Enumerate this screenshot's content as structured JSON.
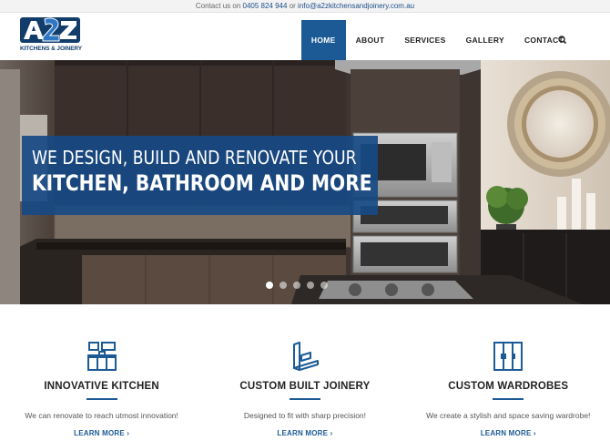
{
  "topbar": {
    "prefix": "Contact us on",
    "phone": "0405 824 944",
    "or": "or",
    "email": "info@a2zkitchensandjoinery.com.au"
  },
  "logo": {
    "mark": "A2Z",
    "subtitle": "KITCHENS & JOINERY"
  },
  "nav": {
    "items": [
      {
        "label": "HOME",
        "active": true
      },
      {
        "label": "ABOUT",
        "active": false
      },
      {
        "label": "SERVICES",
        "active": false
      },
      {
        "label": "GALLERY",
        "active": false
      },
      {
        "label": "CONTACT",
        "active": false
      }
    ],
    "search_icon": "search-icon"
  },
  "hero": {
    "line1": "WE DESIGN, BUILD AND RENOVATE YOUR",
    "line2": "KITCHEN, BATHROOM AND MORE",
    "slides": 5,
    "active_slide": 1
  },
  "features": [
    {
      "icon": "kitchen-icon",
      "title": "INNOVATIVE KITCHEN",
      "desc": "We can renovate to reach utmost innovation!",
      "more": "LEARN MORE ›"
    },
    {
      "icon": "joinery-icon",
      "title": "CUSTOM BUILT JOINERY",
      "desc": "Designed to fit with sharp precision!",
      "more": "LEARN MORE ›"
    },
    {
      "icon": "wardrobe-icon",
      "title": "CUSTOM WARDROBES",
      "desc": "We create a stylish and space saving wardrobe!",
      "more": "LEARN MORE ›"
    }
  ],
  "colors": {
    "brand_blue": "#1c5a95",
    "banner_blue": "#174a84",
    "dark_text": "#222222"
  }
}
